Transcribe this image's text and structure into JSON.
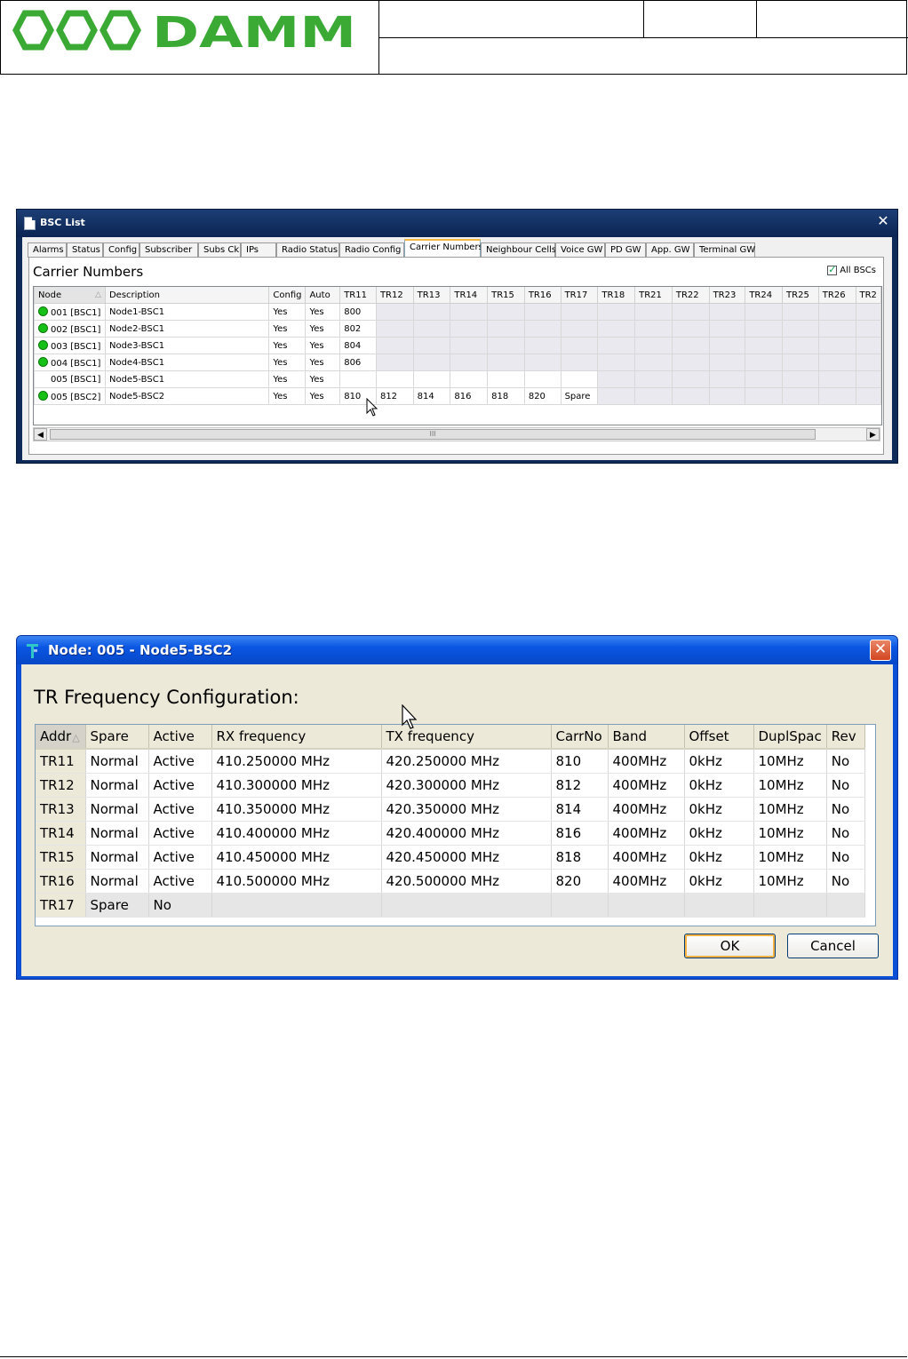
{
  "document": {
    "logo_text": "DAMM"
  },
  "bsc_list": {
    "title": "BSC List",
    "close_glyph": "✕",
    "tabs": [
      "Alarms",
      "Status",
      "Config",
      "Subscriber",
      "Subs Ck",
      "IPs",
      "Radio Status",
      "Radio Config",
      "Carrier Numbers",
      "Neighbour Cells",
      "Voice GW",
      "PD GW",
      "App. GW",
      "Terminal GW"
    ],
    "active_tab": "Carrier Numbers",
    "panel_title": "Carrier Numbers",
    "all_bscs_label": "All BSCs",
    "all_bscs_checked": true,
    "columns": [
      "Node",
      "Description",
      "Config",
      "Auto",
      "TR11",
      "TR12",
      "TR13",
      "TR14",
      "TR15",
      "TR16",
      "TR17",
      "TR18",
      "TR21",
      "TR22",
      "TR23",
      "TR24",
      "TR25",
      "TR26",
      "TR2"
    ],
    "sort_indicator": "△",
    "rows": [
      {
        "status": "green",
        "node": "001 [BSC1]",
        "description": "Node1-BSC1",
        "config": "Yes",
        "auto": "Yes",
        "trs": [
          "800"
        ]
      },
      {
        "status": "green",
        "node": "002 [BSC1]",
        "description": "Node2-BSC1",
        "config": "Yes",
        "auto": "Yes",
        "trs": [
          "802"
        ]
      },
      {
        "status": "green",
        "node": "003 [BSC1]",
        "description": "Node3-BSC1",
        "config": "Yes",
        "auto": "Yes",
        "trs": [
          "804"
        ]
      },
      {
        "status": "green",
        "node": "004 [BSC1]",
        "description": "Node4-BSC1",
        "config": "Yes",
        "auto": "Yes",
        "trs": [
          "806"
        ]
      },
      {
        "status": "none",
        "node": "005 [BSC1]",
        "description": "Node5-BSC1",
        "config": "Yes",
        "auto": "Yes",
        "trs": [
          "",
          "",
          "",
          "",
          "",
          "",
          ""
        ]
      },
      {
        "status": "green",
        "node": "005 [BSC2]",
        "description": "Node5-BSC2",
        "config": "Yes",
        "auto": "Yes",
        "trs": [
          "810",
          "812",
          "814",
          "816",
          "818",
          "820",
          "Spare"
        ]
      }
    ],
    "scroll_grip": "III"
  },
  "node_dialog": {
    "title": "Node: 005 - Node5-BSC2",
    "close_glyph": "✕",
    "heading": "TR Frequency Configuration:",
    "columns": [
      "Addr",
      "Spare",
      "Active",
      "RX frequency",
      "TX frequency",
      "CarrNo",
      "Band",
      "Offset",
      "DuplSpac",
      "Rev"
    ],
    "sort_indicator": "△",
    "rows": [
      [
        "TR11",
        "Normal",
        "Active",
        "410.250000 MHz",
        "420.250000 MHz",
        "810",
        "400MHz",
        "0kHz",
        "10MHz",
        "No"
      ],
      [
        "TR12",
        "Normal",
        "Active",
        "410.300000 MHz",
        "420.300000 MHz",
        "812",
        "400MHz",
        "0kHz",
        "10MHz",
        "No"
      ],
      [
        "TR13",
        "Normal",
        "Active",
        "410.350000 MHz",
        "420.350000 MHz",
        "814",
        "400MHz",
        "0kHz",
        "10MHz",
        "No"
      ],
      [
        "TR14",
        "Normal",
        "Active",
        "410.400000 MHz",
        "420.400000 MHz",
        "816",
        "400MHz",
        "0kHz",
        "10MHz",
        "No"
      ],
      [
        "TR15",
        "Normal",
        "Active",
        "410.450000 MHz",
        "420.450000 MHz",
        "818",
        "400MHz",
        "0kHz",
        "10MHz",
        "No"
      ],
      [
        "TR16",
        "Normal",
        "Active",
        "410.500000 MHz",
        "420.500000 MHz",
        "820",
        "400MHz",
        "0kHz",
        "10MHz",
        "No"
      ],
      [
        "TR17",
        "Spare",
        "No",
        "",
        "",
        "",
        "",
        "",
        "",
        ""
      ]
    ],
    "ok_label": "OK",
    "cancel_label": "Cancel"
  },
  "colors": {
    "logo_green": "#3aaa35",
    "status_green": "#16c016",
    "bsc_titlebar": "#0b2452",
    "xp_titlebar": "#0a56e3"
  }
}
